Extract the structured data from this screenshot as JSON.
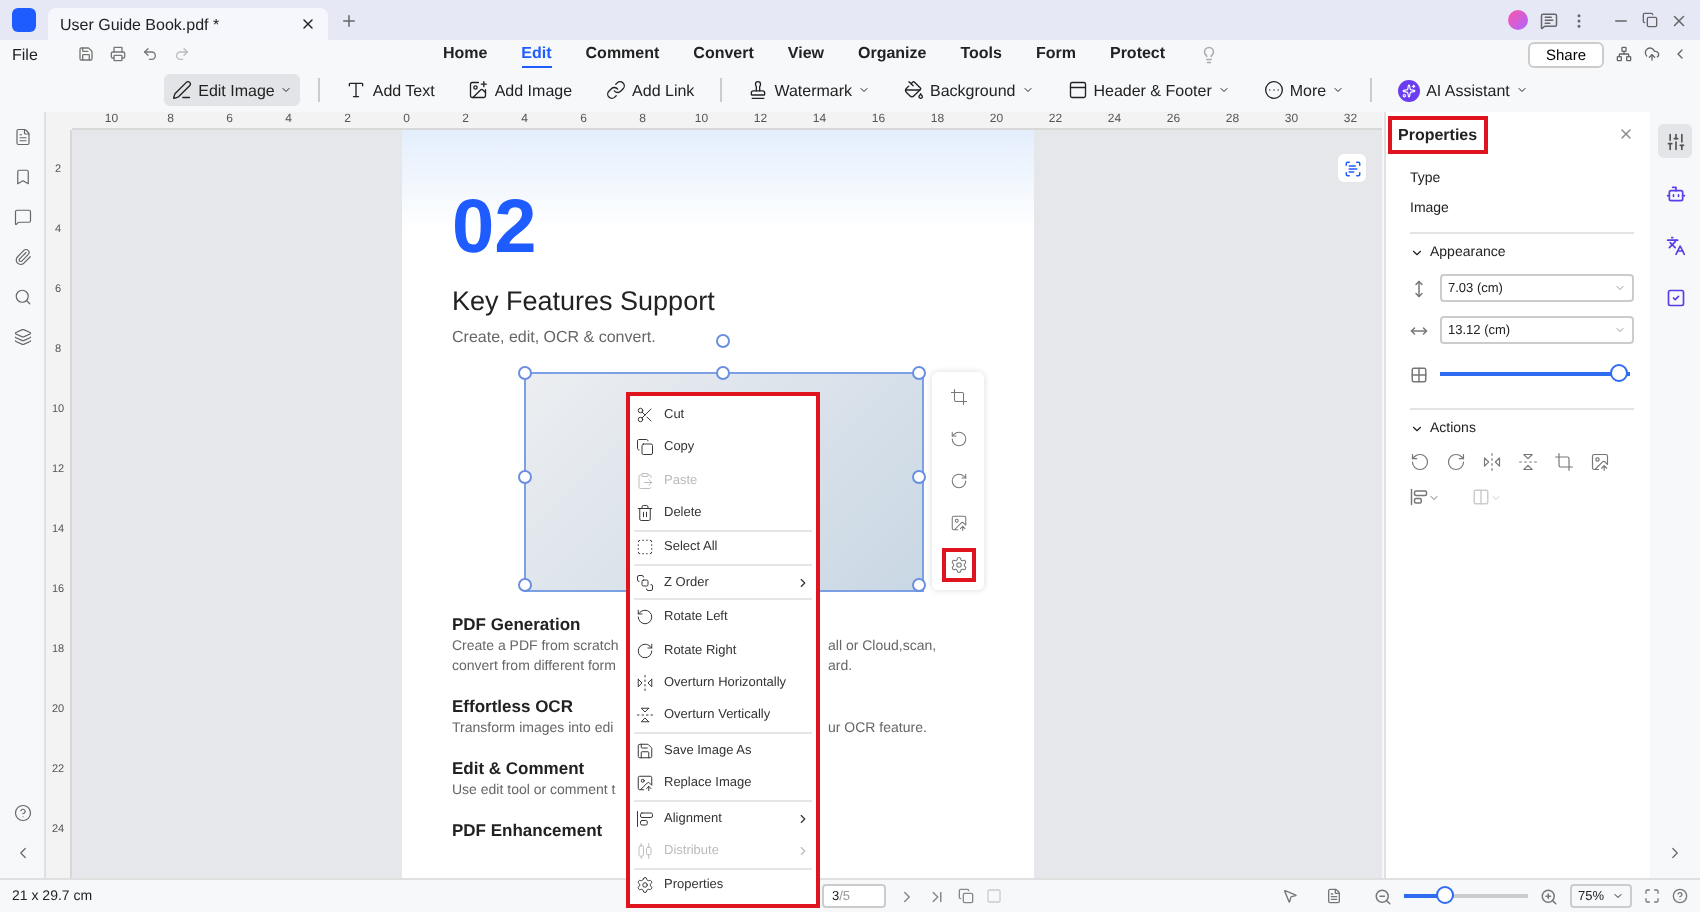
{
  "title_bar": {
    "tab_title": "User Guide Book.pdf *"
  },
  "menu_bar": {
    "file": "File",
    "share": "Share",
    "tabs": [
      {
        "label": "Home",
        "selected": false
      },
      {
        "label": "Edit",
        "selected": true
      },
      {
        "label": "Comment",
        "selected": false
      },
      {
        "label": "Convert",
        "selected": false
      },
      {
        "label": "View",
        "selected": false
      },
      {
        "label": "Organize",
        "selected": false
      },
      {
        "label": "Tools",
        "selected": false
      },
      {
        "label": "Form",
        "selected": false
      },
      {
        "label": "Protect",
        "selected": false
      }
    ]
  },
  "toolbar": {
    "items": [
      {
        "label": "Edit Image",
        "selected": true,
        "dropdown": true
      },
      {
        "label": "Add Text",
        "selected": false,
        "dropdown": false
      },
      {
        "label": "Add Image",
        "selected": false,
        "dropdown": false
      },
      {
        "label": "Add Link",
        "selected": false,
        "dropdown": false
      },
      {
        "label": "Watermark",
        "selected": false,
        "dropdown": true
      },
      {
        "label": "Background",
        "selected": false,
        "dropdown": true
      },
      {
        "label": "Header & Footer",
        "selected": false,
        "dropdown": true
      },
      {
        "label": "More",
        "selected": false,
        "dropdown": true
      },
      {
        "label": "AI Assistant",
        "selected": false,
        "dropdown": true
      }
    ]
  },
  "rulers": {
    "horizontal": [
      "10",
      "8",
      "6",
      "4",
      "2",
      "0",
      "2",
      "4",
      "6",
      "8",
      "10",
      "12",
      "14",
      "16",
      "18",
      "20",
      "22",
      "24",
      "26",
      "28",
      "30",
      "32"
    ],
    "vertical": [
      "2",
      "4",
      "6",
      "8",
      "10",
      "12",
      "14",
      "16",
      "18",
      "20",
      "22",
      "24"
    ]
  },
  "page": {
    "number": "02",
    "heading": "Key Features Support",
    "subtitle": "Create, edit, OCR & convert.",
    "sections": [
      {
        "title": "PDF Generation",
        "lines": [
          {
            "left": "Create a PDF from scratch",
            "right": "all or Cloud,scan,"
          },
          {
            "left": "convert from different form",
            "right": "ard."
          }
        ]
      },
      {
        "title": "Effortless OCR",
        "lines": [
          {
            "left": "Transform images into edi",
            "right": "ur OCR feature."
          }
        ]
      },
      {
        "title": "Edit & Comment",
        "lines": [
          {
            "left": "Use edit tool or comment t"
          }
        ]
      },
      {
        "title": "PDF Enhancement"
      }
    ]
  },
  "image_toolbar": [
    {
      "highlighted": false
    },
    {
      "highlighted": false
    },
    {
      "highlighted": false
    },
    {
      "highlighted": false
    },
    {
      "highlighted": true
    }
  ],
  "context_menu": {
    "highlighted": true,
    "items": [
      {
        "kind": "item",
        "label": "Cut",
        "disabled": false,
        "submenu": false
      },
      {
        "kind": "item",
        "label": "Copy",
        "disabled": false,
        "submenu": false
      },
      {
        "kind": "item",
        "label": "Paste",
        "disabled": true,
        "submenu": false
      },
      {
        "kind": "item",
        "label": "Delete",
        "disabled": false,
        "submenu": false
      },
      {
        "kind": "separator"
      },
      {
        "kind": "item",
        "label": "Select All",
        "disabled": false,
        "submenu": false
      },
      {
        "kind": "separator"
      },
      {
        "kind": "item",
        "label": "Z Order",
        "disabled": false,
        "submenu": true
      },
      {
        "kind": "separator"
      },
      {
        "kind": "item",
        "label": "Rotate Left",
        "disabled": false,
        "submenu": false
      },
      {
        "kind": "item",
        "label": "Rotate Right",
        "disabled": false,
        "submenu": false
      },
      {
        "kind": "item",
        "label": "Overturn Horizontally",
        "disabled": false,
        "submenu": false
      },
      {
        "kind": "item",
        "label": "Overturn Vertically",
        "disabled": false,
        "submenu": false
      },
      {
        "kind": "separator"
      },
      {
        "kind": "item",
        "label": "Save Image As",
        "disabled": false,
        "submenu": false
      },
      {
        "kind": "item",
        "label": "Replace Image",
        "disabled": false,
        "submenu": false
      },
      {
        "kind": "separator"
      },
      {
        "kind": "item",
        "label": "Alignment",
        "disabled": false,
        "submenu": true
      },
      {
        "kind": "item",
        "label": "Distribute",
        "disabled": true,
        "submenu": true
      },
      {
        "kind": "separator"
      },
      {
        "kind": "item",
        "label": "Properties",
        "disabled": false,
        "submenu": false
      }
    ]
  },
  "properties": {
    "title": "Properties",
    "title_highlighted": true,
    "type_label": "Type",
    "type_value": "Image",
    "appearance": {
      "label": "Appearance",
      "expanded": true,
      "height": "7.03 (cm)",
      "width": "13.12 (cm)",
      "opacity": {
        "level": 1.0
      }
    },
    "actions": {
      "label": "Actions",
      "expanded": true,
      "align_disabled": false,
      "distribute_disabled": true
    }
  },
  "right_rail": [
    {
      "selected": true
    },
    {
      "selected": false
    },
    {
      "selected": false
    },
    {
      "selected": false
    }
  ],
  "status_bar": {
    "page_size": "21 x 29.7 cm",
    "page_current": "3",
    "page_total": "/5",
    "zoom_slider": {
      "level": 0.3
    },
    "zoom": "75%"
  }
}
